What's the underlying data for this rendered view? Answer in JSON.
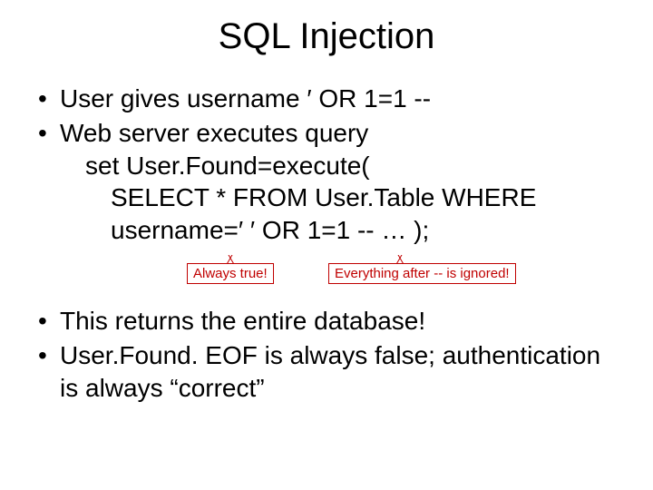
{
  "title": "SQL Injection",
  "bullets": {
    "b1": "User gives username ′ OR 1=1 --",
    "b2": "Web server executes query",
    "b2_sub1": "set User.Found=execute(",
    "b2_sub2a": "SELECT * FROM User.Table WHERE",
    "b2_sub2b": "username=′ ′ OR 1=1 -- … );",
    "b3": "This returns the entire database!",
    "b4": "User.Found. EOF is always false; authentication is always “correct”"
  },
  "annotations": {
    "always_true": "Always true!",
    "ignored": "Everything after -- is ignored!"
  }
}
